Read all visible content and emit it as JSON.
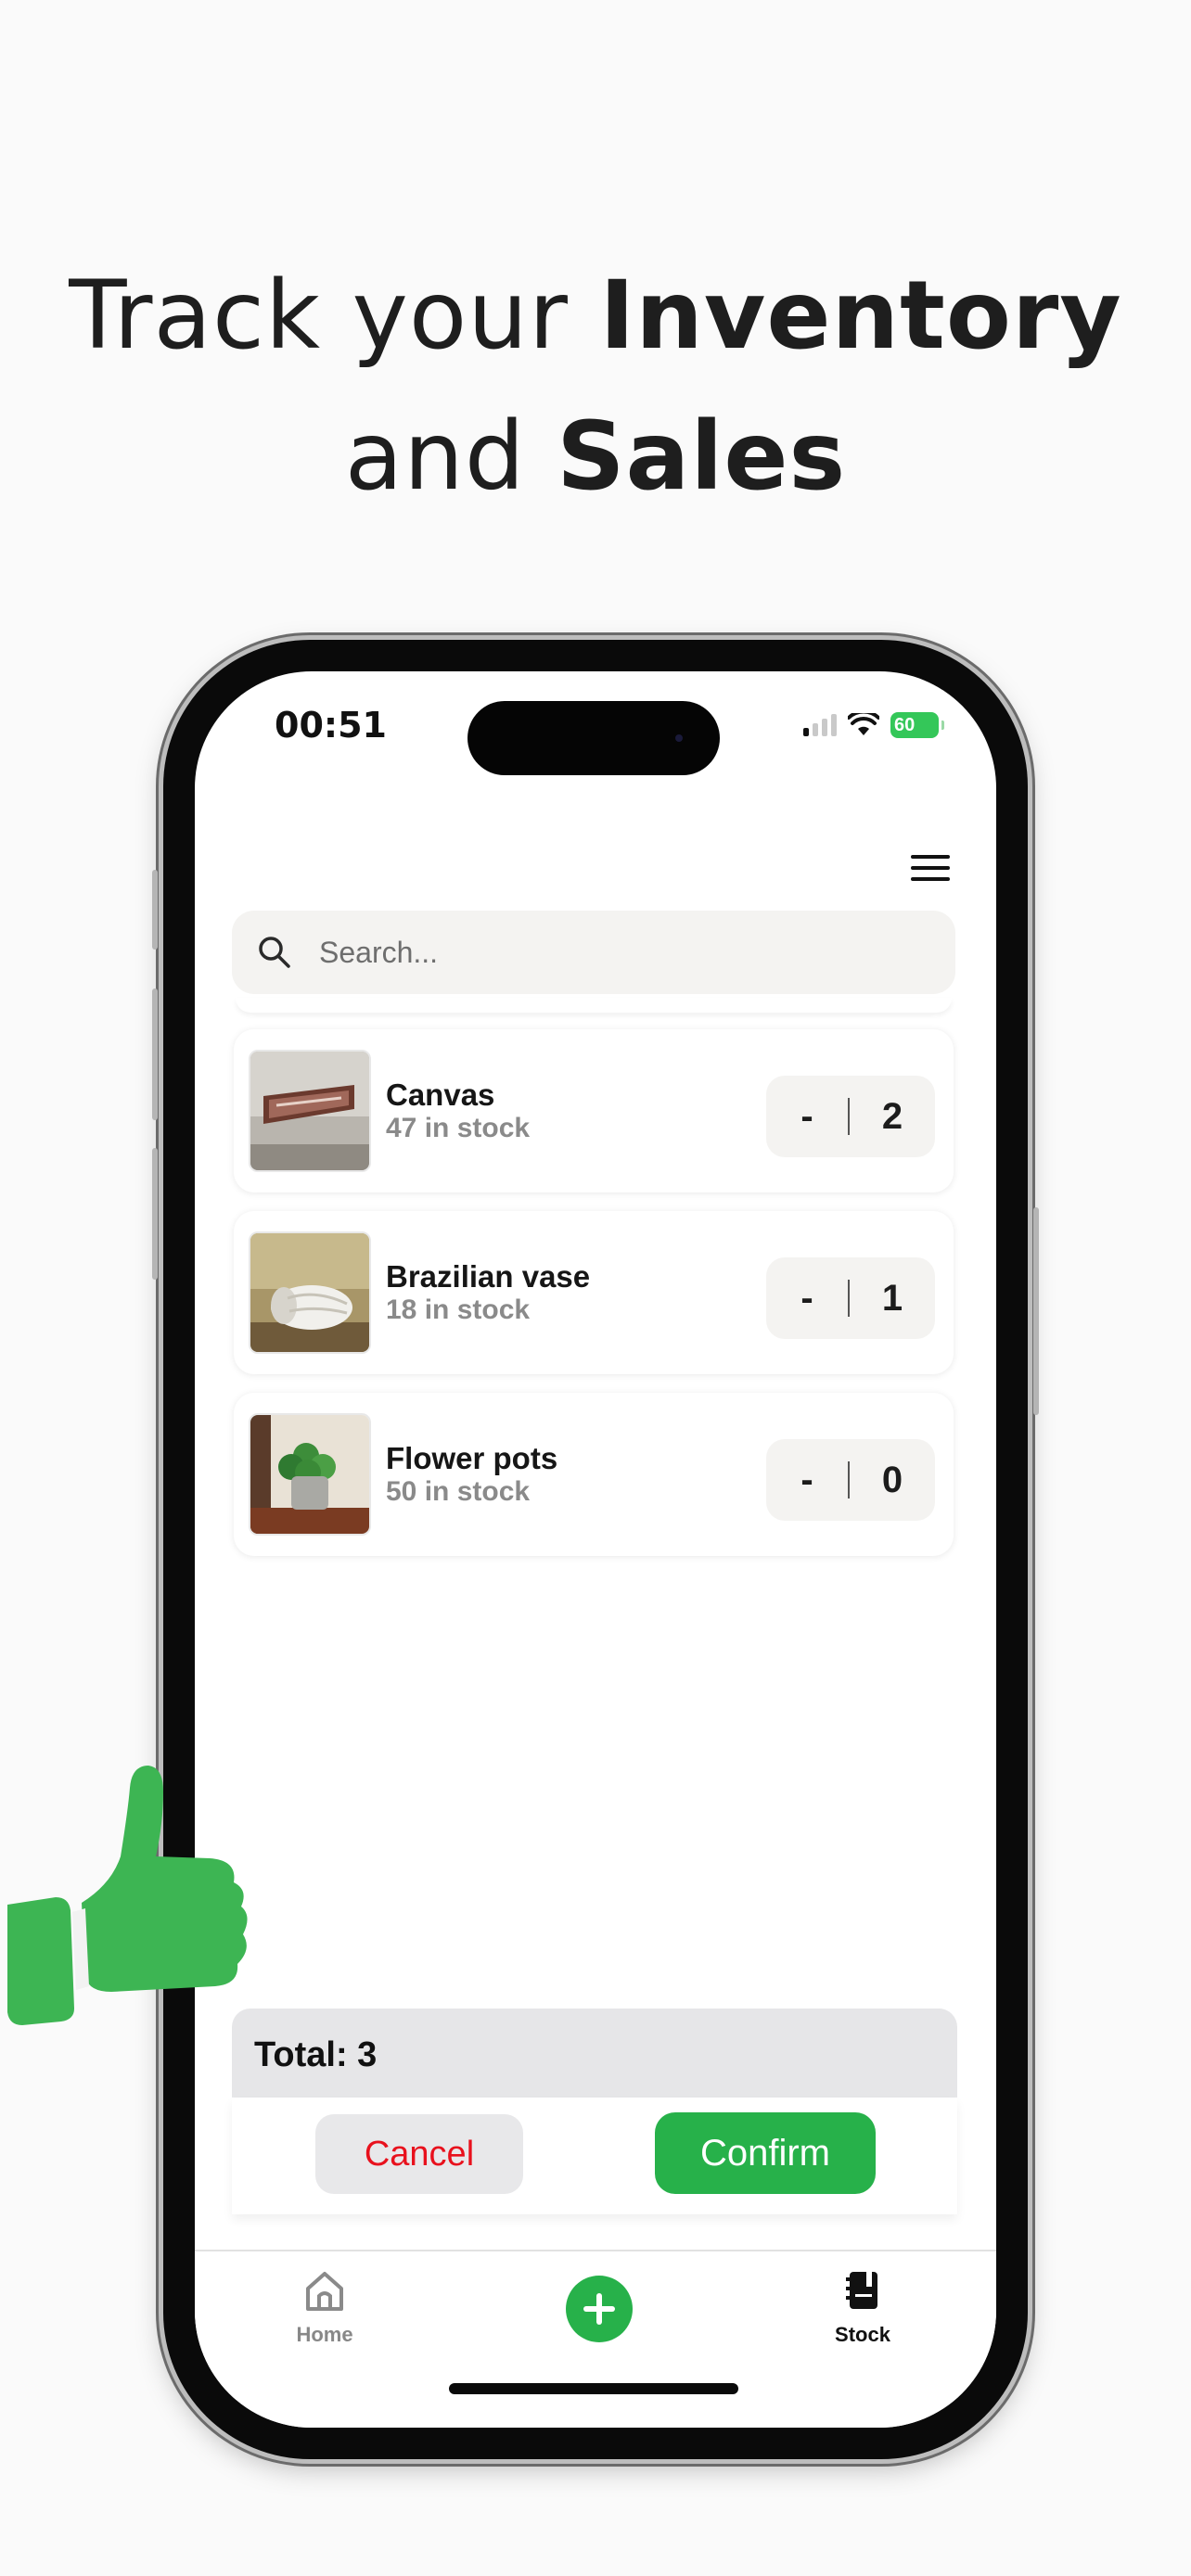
{
  "headline": {
    "line1_regular": "Track your ",
    "line1_bold": "Inventory",
    "line2_regular": "and ",
    "line2_bold": "Sales"
  },
  "status_bar": {
    "time": "00:51",
    "battery": "60"
  },
  "search": {
    "placeholder": "Search..."
  },
  "items": [
    {
      "name": "Canvas",
      "stock": "47 in stock",
      "minus": "-",
      "count": "2"
    },
    {
      "name": "Brazilian vase",
      "stock": "18 in stock",
      "minus": "-",
      "count": "1"
    },
    {
      "name": "Flower pots",
      "stock": "50 in stock",
      "minus": "-",
      "count": "0"
    }
  ],
  "summary": {
    "total": "Total: 3",
    "cancel": "Cancel",
    "confirm": "Confirm"
  },
  "tabbar": {
    "home": "Home",
    "stock": "Stock"
  },
  "colors": {
    "accent_green": "#27b14a",
    "cancel_red": "#e8111d",
    "thumbs_up_green": "#3db553"
  },
  "icons": [
    "search-icon",
    "menu-icon",
    "home-icon",
    "plus-icon",
    "stock-book-icon",
    "thumbs-up-icon"
  ]
}
